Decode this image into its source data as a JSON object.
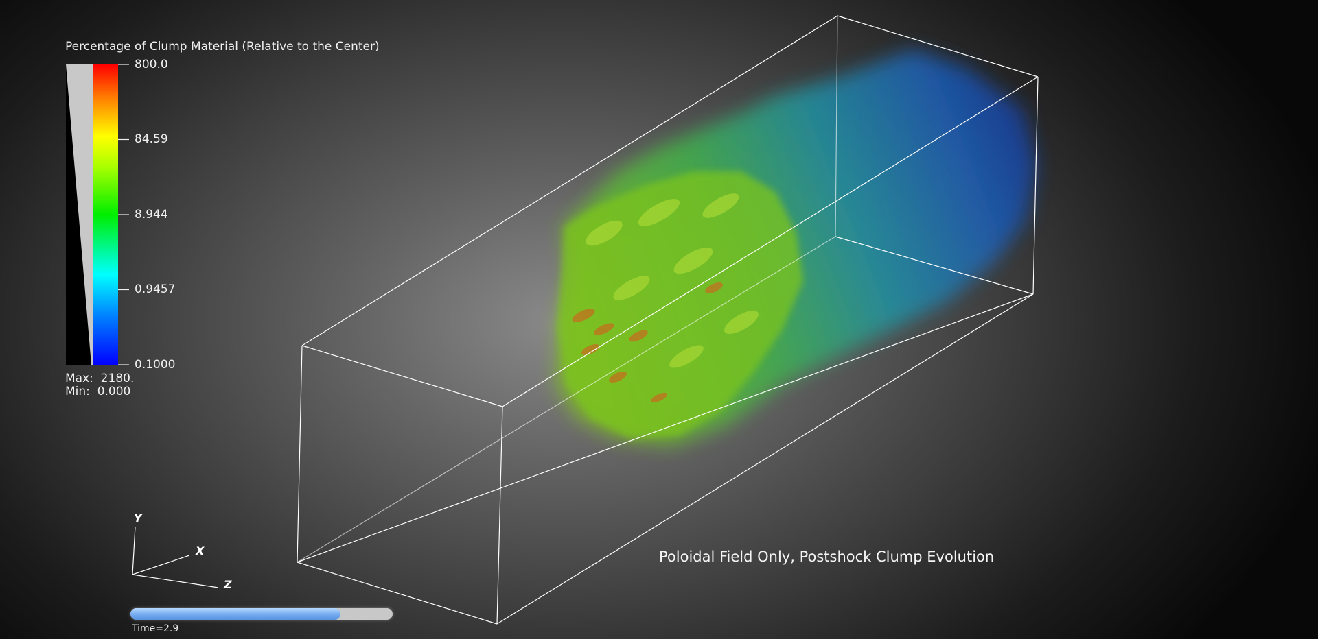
{
  "legend": {
    "title": "Percentage of Clump Material (Relative to the Center)",
    "ticks": [
      "800.0",
      "84.59",
      "8.944",
      "0.9457",
      "0.1000"
    ],
    "max_label": "Max:  2180.",
    "min_label": "Min:  0.000",
    "scale": "log",
    "colormap": [
      "#0000ff",
      "#00aaff",
      "#00ffff",
      "#00ff00",
      "#aaff00",
      "#ffff00",
      "#ff9900",
      "#ff0000"
    ]
  },
  "axes": {
    "x_label": "X",
    "y_label": "Y",
    "z_label": "Z"
  },
  "caption": "Poloidal Field Only, Postshock Clump Evolution",
  "time": {
    "label": "Time=2.9",
    "progress": 0.8
  },
  "colors": {
    "background_center": "#8a8a8a",
    "background_edge": "#080808",
    "bounding_box": "#ffffff",
    "time_bar_fill": "#74aaf0"
  }
}
